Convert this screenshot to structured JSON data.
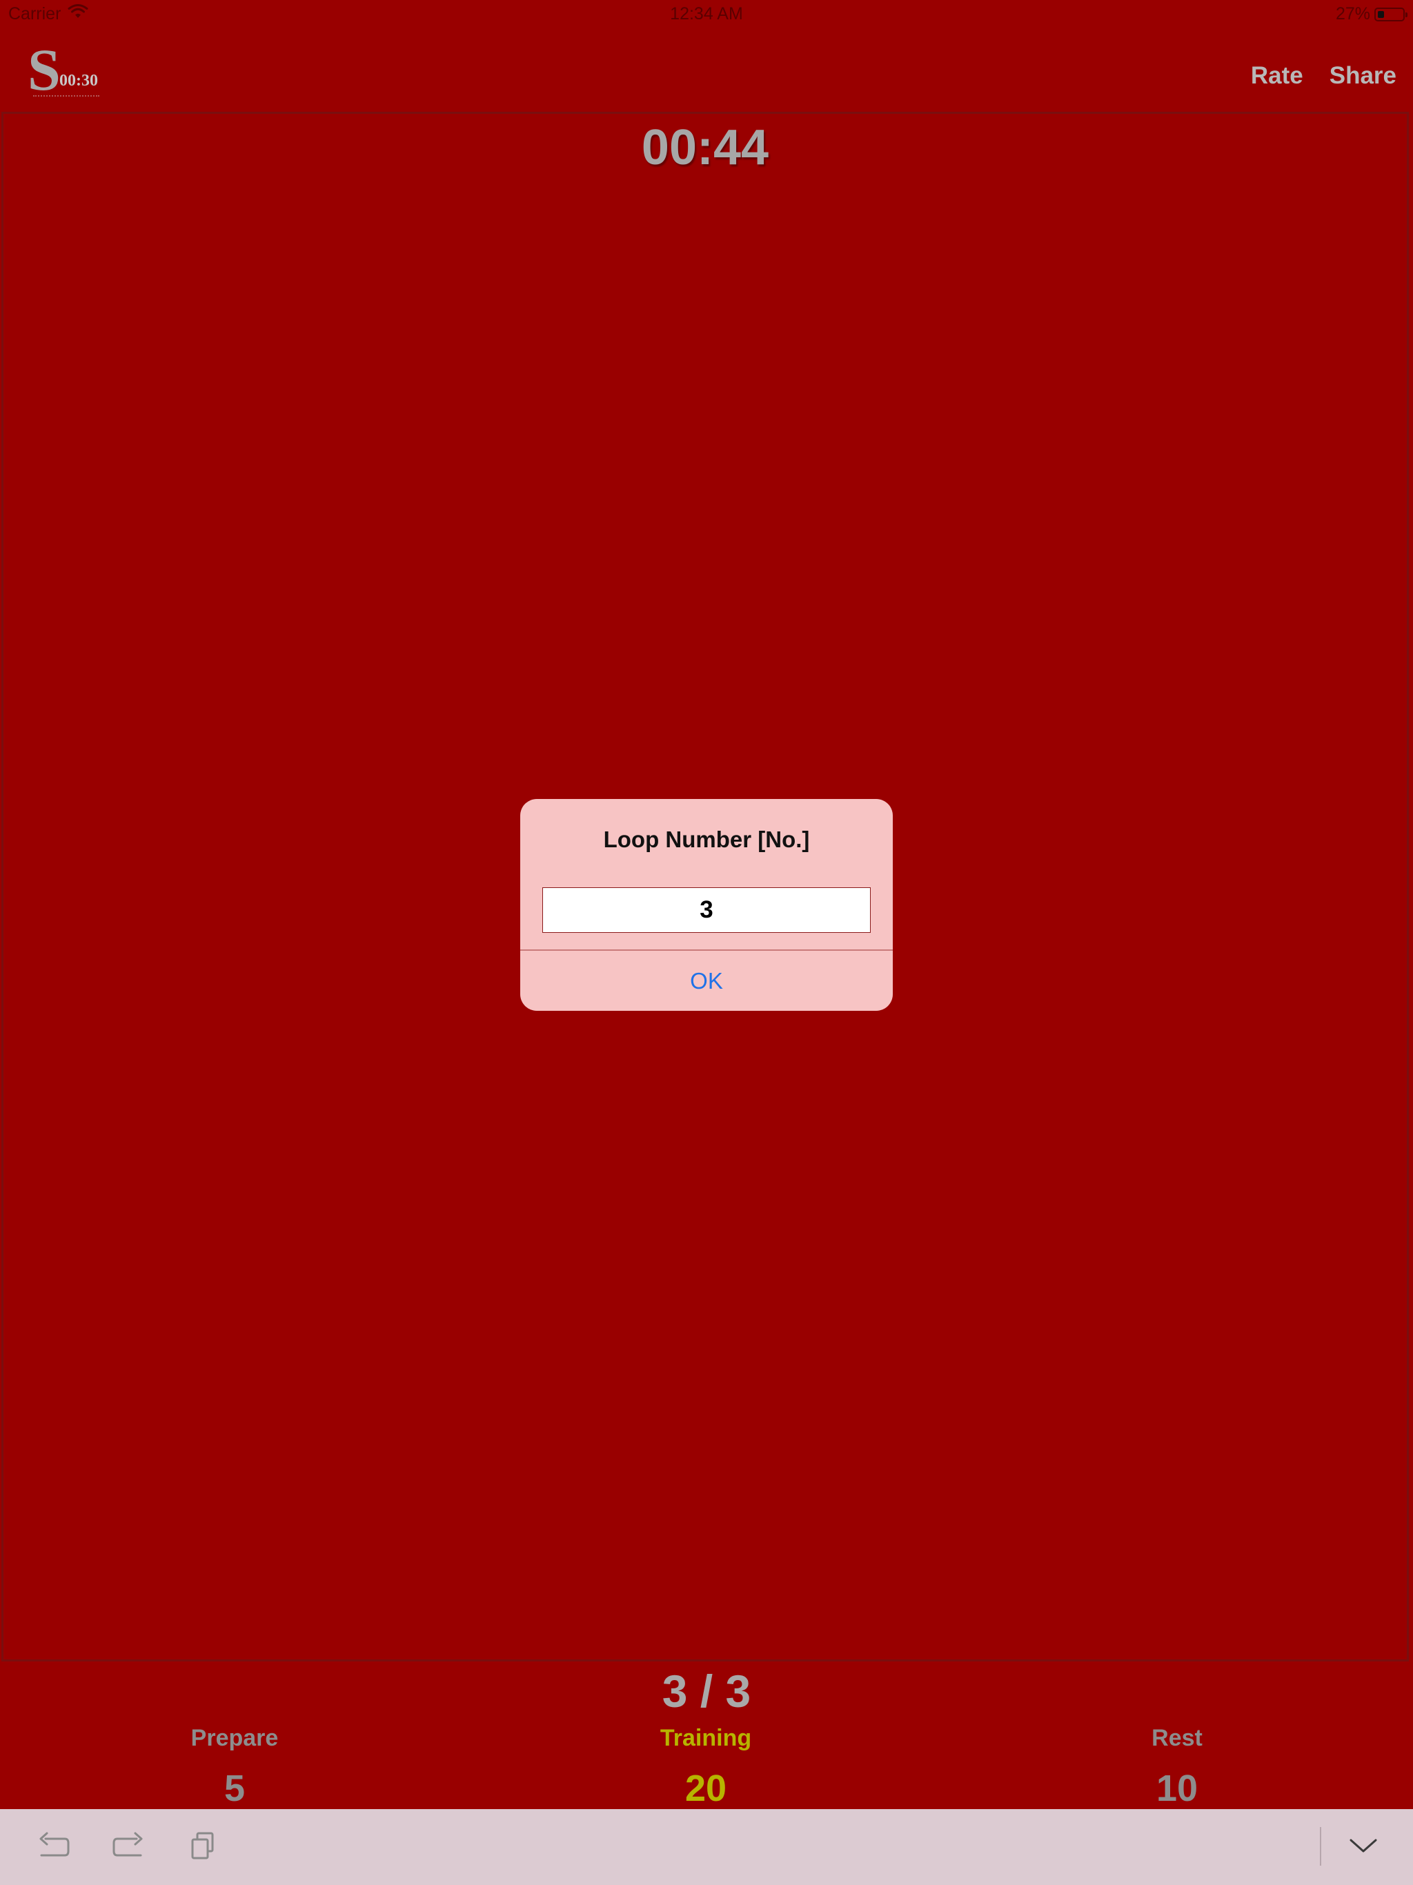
{
  "status_bar": {
    "carrier": "Carrier",
    "time": "12:34 AM",
    "battery": "27%"
  },
  "nav": {
    "logo_letter": "S",
    "logo_time": "00:30",
    "rate_label": "Rate",
    "share_label": "Share"
  },
  "timer": {
    "display": "00:44"
  },
  "alert": {
    "title": "Loop Number [No.]",
    "input_value": "3",
    "ok_label": "OK"
  },
  "loop": {
    "display": "3 / 3"
  },
  "phases": [
    {
      "label": "Prepare",
      "value": "5",
      "active": false
    },
    {
      "label": "Training",
      "value": "20",
      "active": true
    },
    {
      "label": "Rest",
      "value": "10",
      "active": false
    }
  ],
  "colors": {
    "background": "#990000",
    "alert_background": "#f7c4c4",
    "ok_blue": "#1f72e8",
    "active_phase": "#b7b400",
    "inactive_phase": "#8d8d8d",
    "toolbar": "#dccbd2"
  },
  "toolbar": {
    "icons": [
      "undo-icon",
      "redo-icon",
      "paste-icon",
      "keyboard-dismiss-icon"
    ]
  }
}
